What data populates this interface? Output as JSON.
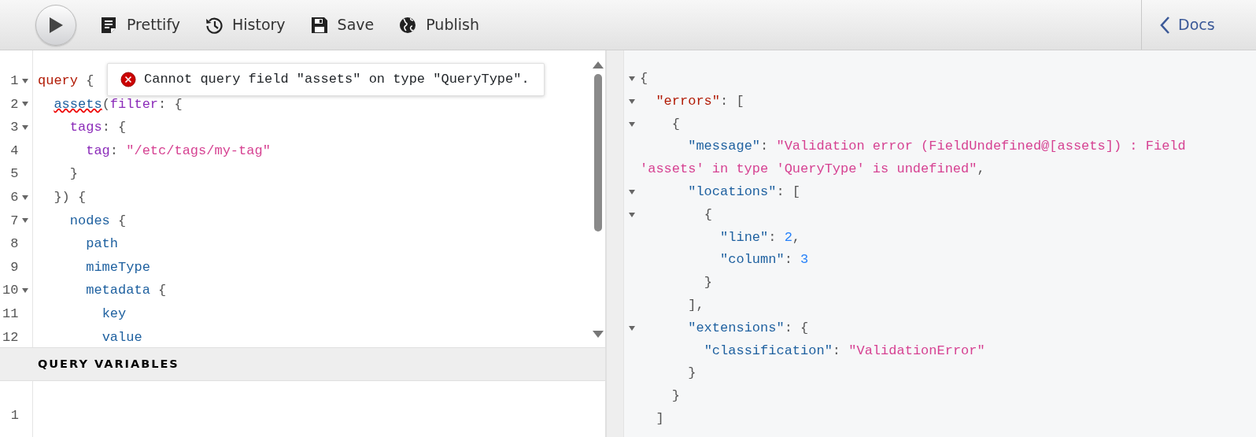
{
  "toolbar": {
    "buttons": [
      {
        "label": "Prettify",
        "kind": "prettify"
      },
      {
        "label": "History",
        "kind": "history"
      },
      {
        "label": "Save",
        "kind": "save"
      },
      {
        "label": "Publish",
        "kind": "publish"
      }
    ],
    "docs_button": {
      "label": "Docs"
    }
  },
  "query_editor": {
    "lines": [
      {
        "number": "1",
        "foldable": true,
        "tokens": [
          {
            "kind": "keyword",
            "text": "query"
          },
          {
            "kind": "punct",
            "text": " {"
          }
        ]
      },
      {
        "number": "2",
        "foldable": true,
        "tokens": [
          {
            "kind": "property",
            "text": "  assets",
            "error": true
          },
          {
            "kind": "punct",
            "text": "("
          },
          {
            "kind": "attribute",
            "text": "filter"
          },
          {
            "kind": "punct",
            "text": ": {"
          }
        ]
      },
      {
        "number": "3",
        "foldable": true,
        "tokens": [
          {
            "kind": "attribute",
            "text": "    tags"
          },
          {
            "kind": "punct",
            "text": ": {"
          }
        ]
      },
      {
        "number": "4",
        "foldable": false,
        "tokens": [
          {
            "kind": "attribute",
            "text": "      tag"
          },
          {
            "kind": "punct",
            "text": ": "
          },
          {
            "kind": "string",
            "text": "\"/etc/tags/my-tag\""
          }
        ]
      },
      {
        "number": "5",
        "foldable": false,
        "tokens": [
          {
            "kind": "punct",
            "text": "    }"
          }
        ]
      },
      {
        "number": "6",
        "foldable": true,
        "tokens": [
          {
            "kind": "punct",
            "text": "  }) {"
          }
        ]
      },
      {
        "number": "7",
        "foldable": true,
        "tokens": [
          {
            "kind": "property",
            "text": "    nodes"
          },
          {
            "kind": "punct",
            "text": " {"
          }
        ]
      },
      {
        "number": "8",
        "foldable": false,
        "tokens": [
          {
            "kind": "property",
            "text": "      path"
          }
        ]
      },
      {
        "number": "9",
        "foldable": false,
        "tokens": [
          {
            "kind": "property",
            "text": "      mimeType"
          }
        ]
      },
      {
        "number": "10",
        "foldable": true,
        "tokens": [
          {
            "kind": "property",
            "text": "      metadata"
          },
          {
            "kind": "punct",
            "text": " {"
          }
        ]
      },
      {
        "number": "11",
        "foldable": false,
        "tokens": [
          {
            "kind": "property",
            "text": "        key"
          }
        ]
      },
      {
        "number": "12",
        "foldable": false,
        "tokens": [
          {
            "kind": "property",
            "text": "        value"
          }
        ]
      }
    ],
    "lint_tooltip": {
      "message": "Cannot query field \"assets\" on type \"QueryType\"."
    }
  },
  "variables_panel": {
    "title": "QUERY VARIABLES",
    "lines": [
      {
        "number": "1"
      }
    ]
  },
  "result": {
    "lines": [
      {
        "foldable": true,
        "tokens": [
          {
            "kind": "punct",
            "text": "{"
          }
        ]
      },
      {
        "foldable": true,
        "tokens": [
          {
            "kind": "keyword",
            "text": "  \"errors\""
          },
          {
            "kind": "punct",
            "text": ": ["
          }
        ]
      },
      {
        "foldable": true,
        "tokens": [
          {
            "kind": "punct",
            "text": "    {"
          }
        ]
      },
      {
        "foldable": false,
        "tokens": [
          {
            "kind": "property",
            "text": "      \"message\""
          },
          {
            "kind": "punct",
            "text": ": "
          },
          {
            "kind": "string",
            "text": "\"Validation error (FieldUndefined@[assets]) : Field 'assets' in type 'QueryType' is undefined\""
          },
          {
            "kind": "punct",
            "text": ","
          }
        ]
      },
      {
        "foldable": true,
        "tokens": [
          {
            "kind": "property",
            "text": "      \"locations\""
          },
          {
            "kind": "punct",
            "text": ": ["
          }
        ]
      },
      {
        "foldable": true,
        "tokens": [
          {
            "kind": "punct",
            "text": "        {"
          }
        ]
      },
      {
        "foldable": false,
        "tokens": [
          {
            "kind": "property",
            "text": "          \"line\""
          },
          {
            "kind": "punct",
            "text": ": "
          },
          {
            "kind": "number",
            "text": "2"
          },
          {
            "kind": "punct",
            "text": ","
          }
        ]
      },
      {
        "foldable": false,
        "tokens": [
          {
            "kind": "property",
            "text": "          \"column\""
          },
          {
            "kind": "punct",
            "text": ": "
          },
          {
            "kind": "number",
            "text": "3"
          }
        ]
      },
      {
        "foldable": false,
        "tokens": [
          {
            "kind": "punct",
            "text": "        }"
          }
        ]
      },
      {
        "foldable": false,
        "tokens": [
          {
            "kind": "punct",
            "text": "      ],"
          }
        ]
      },
      {
        "foldable": true,
        "tokens": [
          {
            "kind": "property",
            "text": "      \"extensions\""
          },
          {
            "kind": "punct",
            "text": ": {"
          }
        ]
      },
      {
        "foldable": false,
        "tokens": [
          {
            "kind": "property",
            "text": "        \"classification\""
          },
          {
            "kind": "punct",
            "text": ": "
          },
          {
            "kind": "string",
            "text": "\"ValidationError\""
          }
        ]
      },
      {
        "foldable": false,
        "tokens": [
          {
            "kind": "punct",
            "text": "      }"
          }
        ]
      },
      {
        "foldable": false,
        "tokens": [
          {
            "kind": "punct",
            "text": "    }"
          }
        ]
      },
      {
        "foldable": false,
        "tokens": [
          {
            "kind": "punct",
            "text": "  ]"
          }
        ]
      }
    ]
  }
}
